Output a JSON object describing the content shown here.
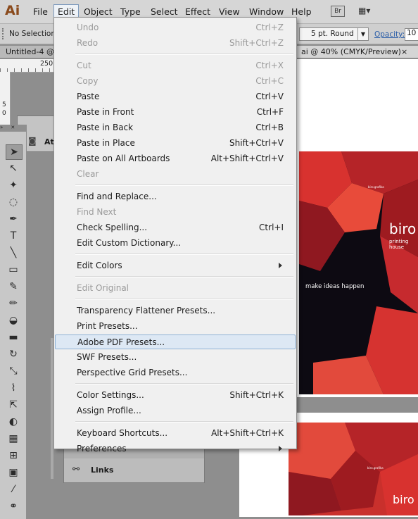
{
  "app": {
    "logo": "Ai",
    "br_label": "Br",
    "workspace_icon": "workspace-switcher-icon"
  },
  "menubar": {
    "items": [
      "File",
      "Edit",
      "Object",
      "Type",
      "Select",
      "Effect",
      "View",
      "Window",
      "Help"
    ],
    "active": "Edit"
  },
  "controlbar": {
    "selection": "No Selection",
    "stroke_profile": "5 pt. Round",
    "opacity_label": "Opacity:",
    "opacity_value": "10"
  },
  "tabs": {
    "left": "Untitled-4 @",
    "right": "ai @ 40% (CMYK/Preview)",
    "close": "×"
  },
  "ruler": {
    "h_label": "250",
    "v_labels": [
      "5",
      "0"
    ]
  },
  "panels": {
    "artboards_label": "At",
    "links_label": "Links"
  },
  "artboard": {
    "brand": "biro",
    "brand_sub": "printing house",
    "tagline": "make ideas happen",
    "small_text": "biro.grafika"
  },
  "edit_menu": {
    "groups": [
      [
        {
          "label": "Undo",
          "shortcut": "Ctrl+Z",
          "disabled": true
        },
        {
          "label": "Redo",
          "shortcut": "Shift+Ctrl+Z",
          "disabled": true
        }
      ],
      [
        {
          "label": "Cut",
          "shortcut": "Ctrl+X",
          "disabled": true
        },
        {
          "label": "Copy",
          "shortcut": "Ctrl+C",
          "disabled": true
        },
        {
          "label": "Paste",
          "shortcut": "Ctrl+V"
        },
        {
          "label": "Paste in Front",
          "shortcut": "Ctrl+F"
        },
        {
          "label": "Paste in Back",
          "shortcut": "Ctrl+B"
        },
        {
          "label": "Paste in Place",
          "shortcut": "Shift+Ctrl+V"
        },
        {
          "label": "Paste on All Artboards",
          "shortcut": "Alt+Shift+Ctrl+V"
        },
        {
          "label": "Clear",
          "shortcut": "",
          "disabled": true
        }
      ],
      [
        {
          "label": "Find and Replace...",
          "shortcut": ""
        },
        {
          "label": "Find Next",
          "shortcut": "",
          "disabled": true
        },
        {
          "label": "Check Spelling...",
          "shortcut": "Ctrl+I"
        },
        {
          "label": "Edit Custom Dictionary...",
          "shortcut": ""
        }
      ],
      [
        {
          "label": "Edit Colors",
          "shortcut": "",
          "submenu": true
        }
      ],
      [
        {
          "label": "Edit Original",
          "shortcut": "",
          "disabled": true
        }
      ],
      [
        {
          "label": "Transparency Flattener Presets...",
          "shortcut": ""
        },
        {
          "label": "Print Presets...",
          "shortcut": ""
        },
        {
          "label": "Adobe PDF Presets...",
          "shortcut": "",
          "highlighted": true
        },
        {
          "label": "SWF Presets...",
          "shortcut": ""
        },
        {
          "label": "Perspective Grid Presets...",
          "shortcut": ""
        }
      ],
      [
        {
          "label": "Color Settings...",
          "shortcut": "Shift+Ctrl+K"
        },
        {
          "label": "Assign Profile...",
          "shortcut": ""
        }
      ],
      [
        {
          "label": "Keyboard Shortcuts...",
          "shortcut": "Alt+Shift+Ctrl+K"
        },
        {
          "label": "Preferences",
          "shortcut": "",
          "submenu": true
        }
      ]
    ]
  },
  "tools": [
    "selection-tool-icon",
    "direct-selection-tool-icon",
    "magic-wand-tool-icon",
    "lasso-tool-icon",
    "pen-tool-icon",
    "type-tool-icon",
    "line-tool-icon",
    "rectangle-tool-icon",
    "paintbrush-tool-icon",
    "pencil-tool-icon",
    "blob-brush-tool-icon",
    "eraser-tool-icon",
    "rotate-tool-icon",
    "scale-tool-icon",
    "warp-tool-icon",
    "free-transform-tool-icon",
    "shape-builder-tool-icon",
    "perspective-grid-tool-icon",
    "mesh-tool-icon",
    "gradient-tool-icon",
    "eyedropper-tool-icon",
    "blend-tool-icon"
  ],
  "colors": {
    "accent_red": "#d8322f",
    "dark": "#0d0a12",
    "highlight": "#dde8f4"
  }
}
